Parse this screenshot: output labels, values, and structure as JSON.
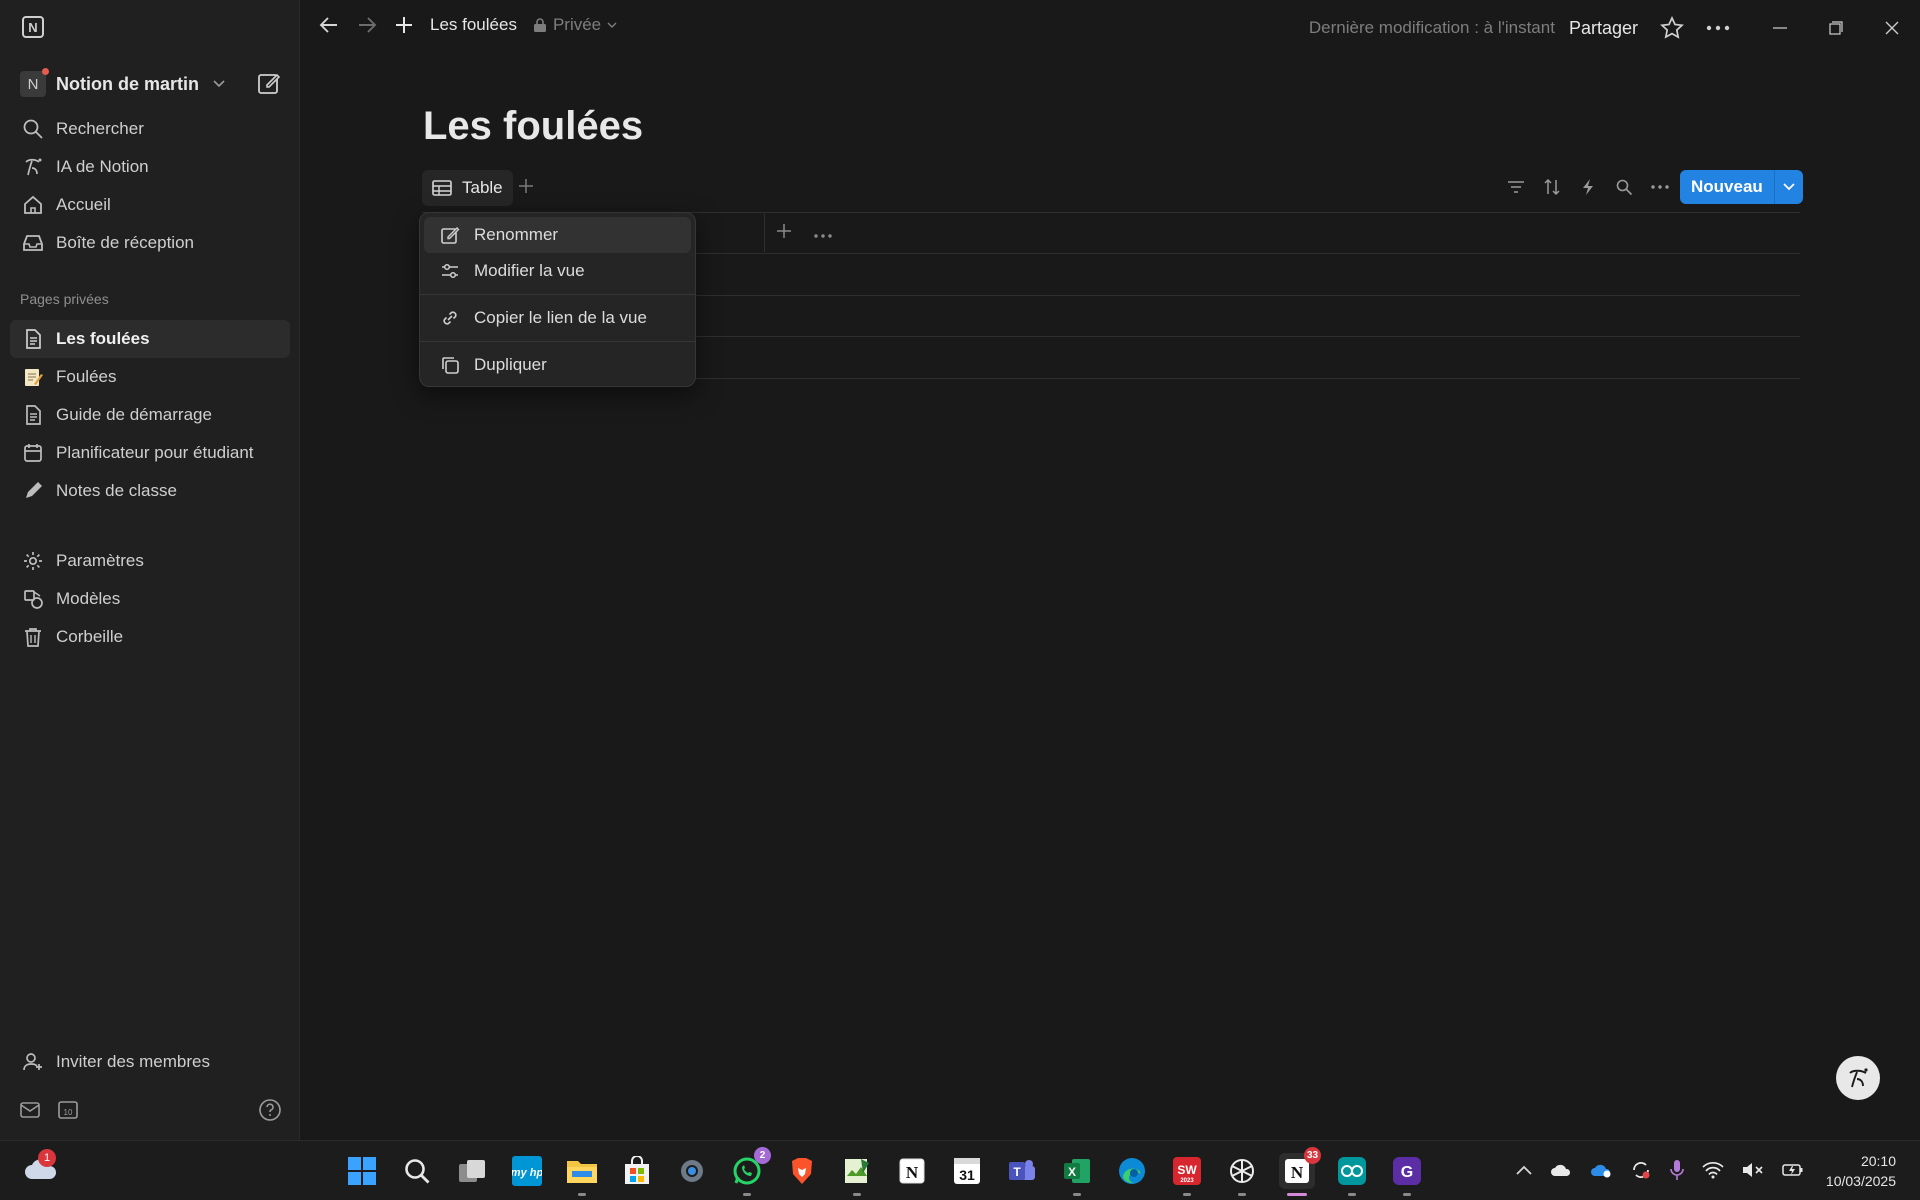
{
  "topbar": {
    "page_title": "Les foulées",
    "privacy": "Privée",
    "last_edit": "Dernière modification : à l'instant",
    "share": "Partager"
  },
  "sidebar": {
    "workspace_initial": "N",
    "workspace_name": "Notion de martin",
    "nav": [
      {
        "label": "Rechercher",
        "icon": "search-icon"
      },
      {
        "label": "IA de Notion",
        "icon": "notion-ai-icon"
      },
      {
        "label": "Accueil",
        "icon": "home-icon"
      },
      {
        "label": "Boîte de réception",
        "icon": "inbox-icon"
      }
    ],
    "section_label": "Pages privées",
    "pages": [
      {
        "label": "Les foulées",
        "icon": "page-icon",
        "active": true
      },
      {
        "label": "Foulées",
        "icon": "memo-icon"
      },
      {
        "label": "Guide de démarrage",
        "icon": "page-icon"
      },
      {
        "label": "Planificateur pour étudiant",
        "icon": "calendar-icon"
      },
      {
        "label": "Notes de classe",
        "icon": "pencil-icon"
      }
    ],
    "utilities": [
      {
        "label": "Paramètres",
        "icon": "gear-icon"
      },
      {
        "label": "Modèles",
        "icon": "templates-icon"
      },
      {
        "label": "Corbeille",
        "icon": "trash-icon"
      }
    ],
    "invite": "Inviter des membres",
    "calendar_day": "10"
  },
  "main": {
    "title": "Les foulées",
    "view_tab": "Table",
    "new_button": "Nouveau"
  },
  "context_menu": {
    "items": [
      "Renommer",
      "Modifier la vue",
      "Copier le lien de la vue",
      "Dupliquer"
    ]
  },
  "taskbar": {
    "weather_badge": "1",
    "whatsapp_badge": "2",
    "notion_badge": "33",
    "calendar_label": "31",
    "time": "20:10",
    "date": "10/03/2025"
  },
  "colors": {
    "accent": "#2383e2",
    "background": "#191919",
    "sidebar": "#202020"
  }
}
